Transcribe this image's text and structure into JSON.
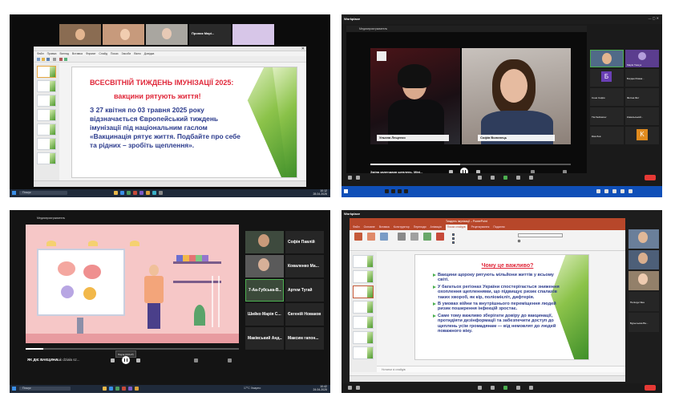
{
  "q1": {
    "participants": [
      {
        "name": "",
        "bg": "#8a6c52"
      },
      {
        "name": "",
        "bg": "#c79a7c"
      },
      {
        "name": "",
        "bg": "#a9a6a0"
      },
      {
        "name": "Проник Марі...",
        "bg": "#2a2a2a"
      },
      {
        "name": "",
        "bg": "#d7c6e8"
      }
    ],
    "slide": {
      "title": "ВСЕСВІТНІЙ ТИЖДЕНЬ ІМУНІЗАЦІЇ 2025:",
      "subtitle": "вакцини рятують життя!",
      "body": "З 27 квітня по 03 травня 2025 року відзначається Європейський тиждень імунізації під національним гаслом «Вакцинація рятує життя. Подбайте про себе та рідних – зробіть щеплення»."
    },
    "menu": [
      "Файл",
      "Правка",
      "Вигляд",
      "Вставка",
      "Формат",
      "Слайд",
      "Показ",
      "Засоби",
      "Вікно",
      "Довідка"
    ],
    "taskbar": {
      "search": "Пошук",
      "time": "10:12",
      "date": "28.04.2025"
    }
  },
  "q2": {
    "app": "Workplace",
    "window_title": "Медиапроигрыватель",
    "video_names": [
      "Ульяна Лещенко",
      "Софія Волинець"
    ],
    "video_title": "Зміна календаря щеплень. Міні...",
    "participants": [
      {
        "name": "",
        "bg": "#506a88"
      },
      {
        "name": "Марія Ткачук",
        "bg": "#5b3d8f"
      },
      {
        "name": "Б",
        "bg": "#6a3fb5"
      },
      {
        "name": "Богдан Ромак...",
        "bg": "#262626"
      },
      {
        "name": "Соня Софія",
        "bg": "#262626"
      },
      {
        "name": "Фотіна Фот",
        "bg": "#262626"
      },
      {
        "name": "Тім Selivanov",
        "bg": "#262626"
      },
      {
        "name": "Ковальський...",
        "bg": "#262626"
      },
      {
        "name": "Єва Лев",
        "bg": "#262626"
      },
      {
        "name": "K",
        "bg": "#e08a1e"
      }
    ]
  },
  "q3": {
    "window_title": "Медиапроигрыватель",
    "video_title": "ЯК ДІЄ ВАКЦИНА...",
    "video_title_2": "Jak działa sz...",
    "tooltip": "Пауза (Ctrl+P)",
    "participants": [
      {
        "name": "Софія Павлій",
        "bg": "#262626"
      },
      {
        "name": "Коваленко Ма...",
        "bg": "#262626"
      },
      {
        "name": "7-Аа-Губська-В...",
        "bg": "#3b4a3a"
      },
      {
        "name": "Артем Тугай",
        "bg": "#262626"
      },
      {
        "name": "Шийко Марія С...",
        "bg": "#262626"
      },
      {
        "name": "Євгеній Новаков",
        "bg": "#262626"
      },
      {
        "name": "Маківський Анд...",
        "bg": "#262626"
      },
      {
        "name": "Максим гапон...",
        "bg": "#262626"
      }
    ],
    "taskbar": {
      "search": "Пошук",
      "weather": "17°C Хмарно",
      "time": "10:42",
      "date": "24.04.2025"
    }
  },
  "q4": {
    "app": "Workplace",
    "window_title": "Тиждень імунізації – PowerPoint",
    "ribbon_tabs": [
      "Файл",
      "Основне",
      "Вставка",
      "Конструктор",
      "Переходи",
      "Анімація",
      "Показ слайдів",
      "Рецензування",
      "Подання"
    ],
    "slide": {
      "title": "Чому це важливо?",
      "bullets": [
        "Вакцини щороку рятують мільйони життів у всьому світі.",
        "У багатьох регіонах України спостерігається зниження охоплення щепленнями, що підвищує ризик спалахів таких хвороб, як кір, поліомієліт, дифтерія.",
        "В умовах війни та внутрішнього переміщення людей ризик поширення інфекцій зростає.",
        "Саме тому важливо зберігати довіру до вакцинації, протидіяти дезінформації та забезпечити доступ до щеплень усім громадянам — від немовлят до людей поважного віку."
      ]
    },
    "notes": "Нотатки зі слайдів",
    "participants": [
      {
        "name": "",
        "bg": "#6a7f9a"
      },
      {
        "name": "",
        "bg": "#4d5f78"
      },
      {
        "name": "",
        "bg": "#93806a"
      },
      {
        "name": "Поліщук Яна",
        "bg": "#262626"
      },
      {
        "name": "Бурыльова Ва...",
        "bg": "#262626"
      }
    ]
  }
}
